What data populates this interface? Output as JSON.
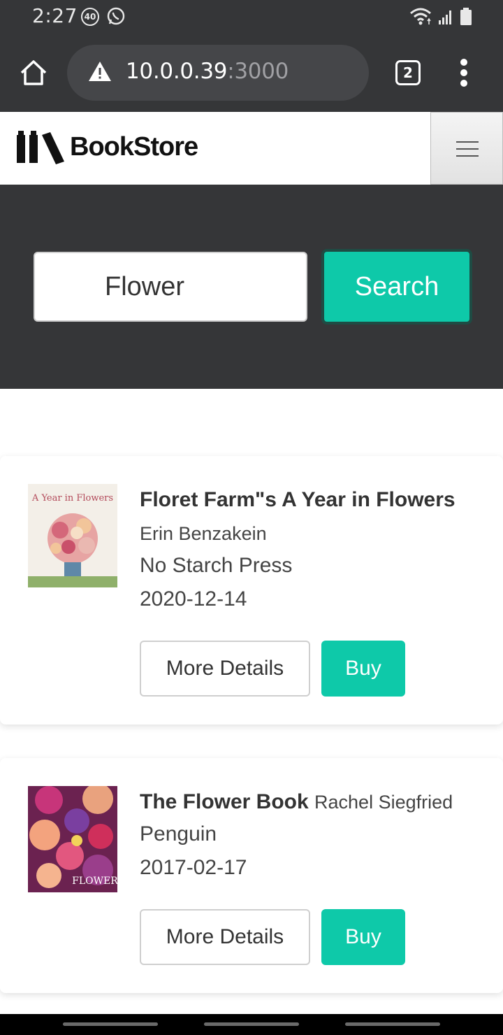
{
  "status_bar": {
    "time": "2:27",
    "notification_count": "40",
    "icons": [
      "whatsapp-icon",
      "wifi-icon",
      "signal-icon",
      "battery-icon"
    ]
  },
  "browser": {
    "url_host": "10.0.0.39",
    "url_port": ":3000",
    "tab_count": "2",
    "icons": [
      "home-icon",
      "warning-icon",
      "tabs-icon",
      "more-vert-icon"
    ]
  },
  "site": {
    "logo_text": "BookStore",
    "menu_icon": "hamburger-icon"
  },
  "search": {
    "value": "Flower",
    "button_label": "Search"
  },
  "results": [
    {
      "title": "Floret Farm\"s A Year in Flowers",
      "author": "Erin Benzakein",
      "publisher": "No Starch Press",
      "date": "2020-12-14",
      "cover_text": "A Year in Flowers",
      "details_label": "More Details",
      "buy_label": "Buy"
    },
    {
      "title": "The Flower Book",
      "author": "Rachel Siegfried",
      "publisher": "Penguin",
      "date": "2017-02-17",
      "cover_text": "FLOWER",
      "details_label": "More Details",
      "buy_label": "Buy"
    }
  ],
  "colors": {
    "accent": "#0ec9a9",
    "dark_bg": "#353638",
    "url_field": "#454649"
  }
}
